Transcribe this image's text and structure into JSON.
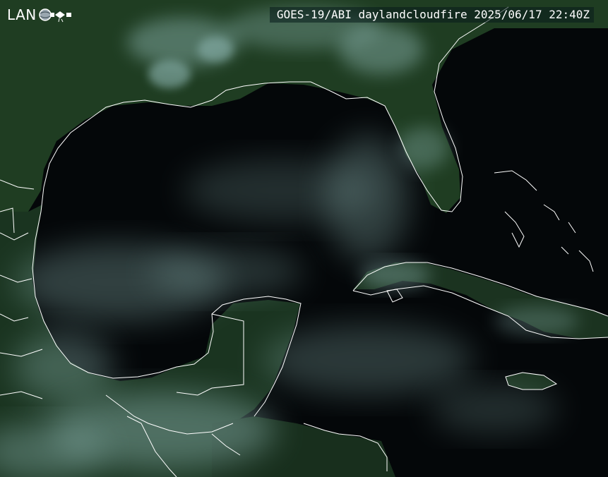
{
  "logo": {
    "text": "LAN",
    "icon": "globe-satellite-icon"
  },
  "banner": {
    "caption": "GOES-19/ABI daylandcloudfire 2025/06/17 22:40Z"
  },
  "colors": {
    "land": "#1c3a22",
    "water": "#050809",
    "cloud": "#8fb8b4",
    "border": "#ffffff"
  }
}
